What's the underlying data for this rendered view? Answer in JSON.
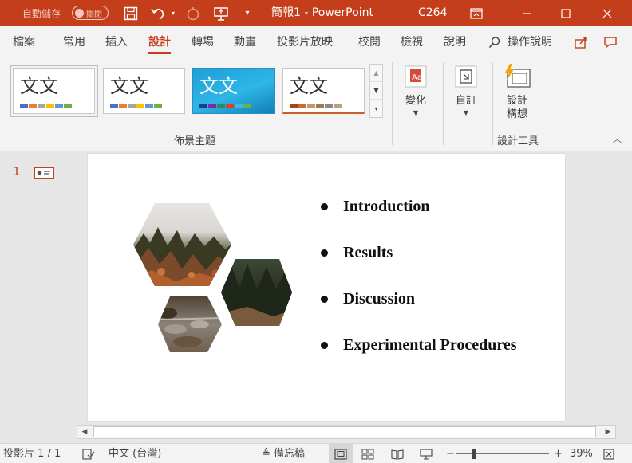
{
  "titlebar": {
    "autosave_label": "自動儲存",
    "autosave_toggle": "關閉",
    "doc_title": "簡報1 - PowerPoint",
    "user": "C264"
  },
  "tabs": [
    "檔案",
    "常用",
    "插入",
    "設計",
    "轉場",
    "動畫",
    "投影片放映",
    "校閱",
    "檢視",
    "說明"
  ],
  "active_tab": "設計",
  "tell_me": "操作說明",
  "ribbon": {
    "theme_glyph": "文文",
    "themes_group_label": "佈景主題",
    "variants_label": "變化",
    "customize_label": "自訂",
    "designer_label_line1": "設計",
    "designer_label_line2": "構想",
    "designer_group_label": "設計工具"
  },
  "thumbnail": {
    "number": "1"
  },
  "slide": {
    "bullets": [
      "Introduction",
      "Results",
      "Discussion",
      "Experimental Procedures"
    ]
  },
  "statusbar": {
    "slide_count": "投影片 1 / 1",
    "language": "中文 (台灣)",
    "notes": "備忘稿",
    "zoom": "39%"
  },
  "colors": {
    "accent": "#c43e1c"
  }
}
